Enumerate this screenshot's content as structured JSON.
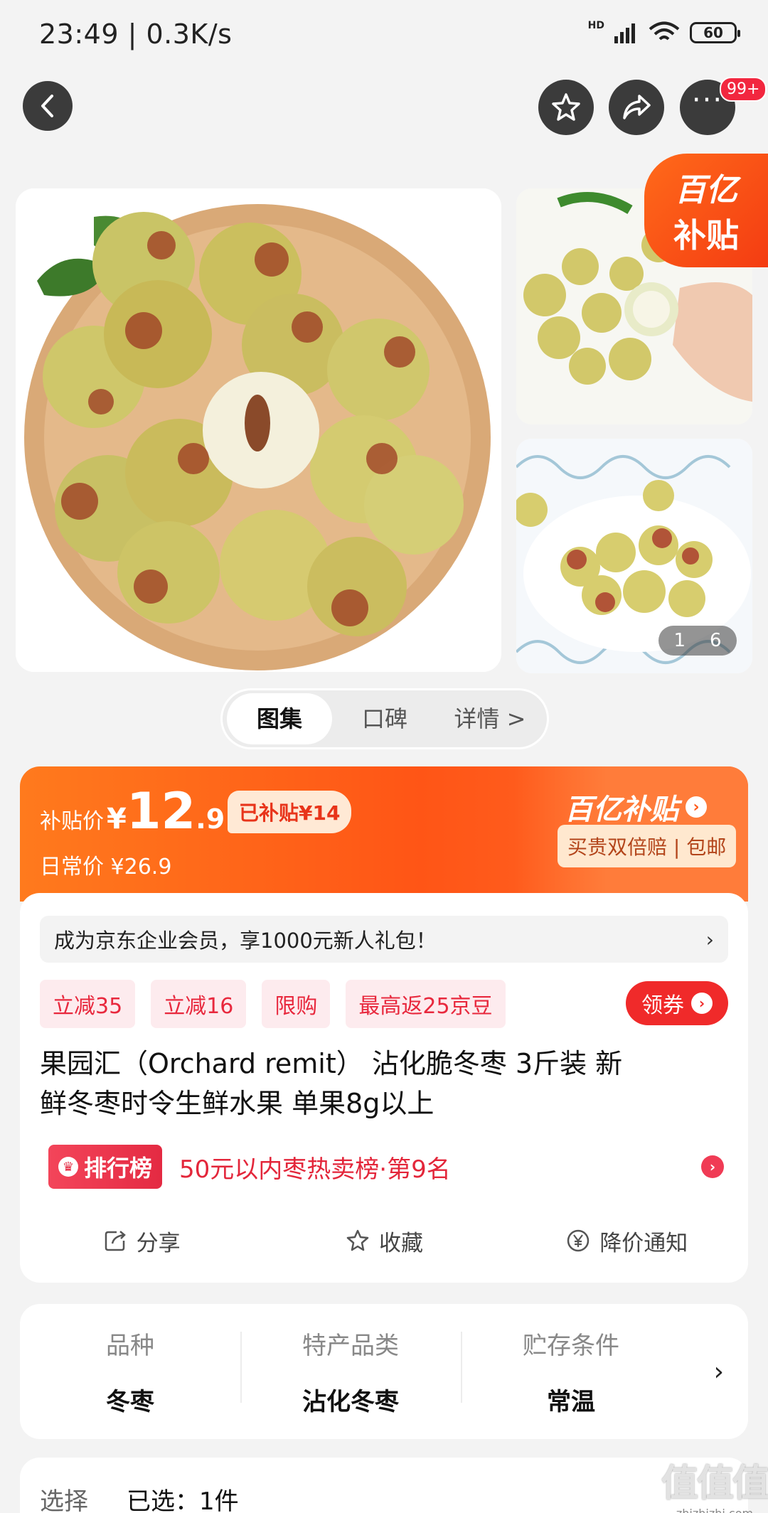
{
  "status_bar": {
    "time": "23:49 | 0.3K/s",
    "hd": "HD",
    "battery": "60"
  },
  "nav": {
    "more_badge": "99+"
  },
  "gallery": {
    "corner_l1": "百亿",
    "corner_l2": "补贴",
    "counter_current": "1",
    "counter_total": "6"
  },
  "segment": {
    "tabs": [
      "图集",
      "口碑",
      "详情 >"
    ]
  },
  "price": {
    "label": "补贴价",
    "symbol": "¥",
    "int": "12",
    "dec": ".9",
    "saved": "已补贴¥14",
    "daily": "日常价 ¥26.9",
    "brand": "百亿补贴",
    "guarantee": "买贵双倍赔 | 包邮"
  },
  "member": {
    "text": "成为京东企业会员，享1000元新人礼包！",
    "chevron": "›"
  },
  "tags": [
    "立减35",
    "立减16",
    "限购",
    "最高返25京豆"
  ],
  "coupon": {
    "label": "领券"
  },
  "product": {
    "title_line1": "果园汇（Orchard remit） 沾化脆冬枣 3斤装 新",
    "title_line2": "鲜冬枣时令生鲜水果 单果8g以上"
  },
  "rank": {
    "badge": "排行榜",
    "text": "50元以内枣热卖榜·第9名"
  },
  "actions": {
    "share": "分享",
    "favorite": "收藏",
    "price_alert": "降价通知"
  },
  "specs": [
    {
      "label": "品种",
      "value": "冬枣"
    },
    {
      "label": "特产品类",
      "value": "沾化冬枣"
    },
    {
      "label": "贮存条件",
      "value": "常温"
    }
  ],
  "select": {
    "label": "选择",
    "value": "已选：1件"
  },
  "watermark": {
    "l1": "值值值",
    "l2": "zhizhizhi.com"
  },
  "colors": {
    "accent": "#ff5516",
    "red": "#e8283d"
  }
}
